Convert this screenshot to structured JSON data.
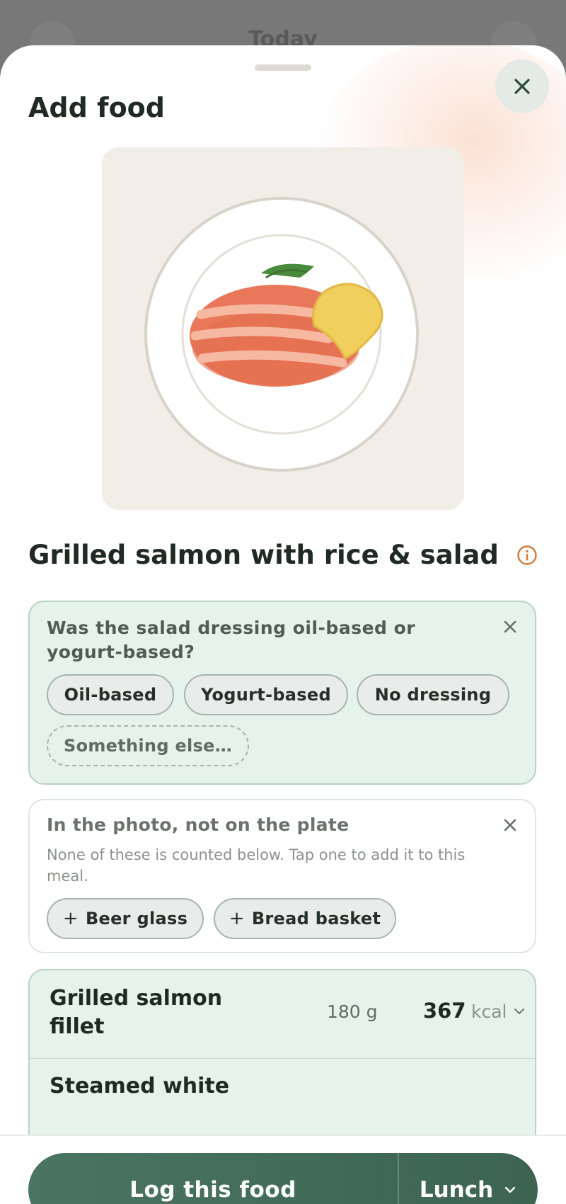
{
  "backdrop": {
    "title": "Today"
  },
  "sheet": {
    "title": "Add food",
    "close_icon": "close-icon"
  },
  "photo": {
    "alt": "Plate with grilled salmon fillet"
  },
  "food": {
    "name": "Grilled salmon with rice & salad",
    "info_icon": "info-icon"
  },
  "question": {
    "text": "Was the salad dressing oil-based or yogurt-based?",
    "options": [
      "Oil-based",
      "Yogurt-based",
      "No dressing"
    ],
    "other_option": "Something else…"
  },
  "photo_extras": {
    "title": "In the photo, not on the plate",
    "subtitle": "None of these is counted below. Tap one to add it to this meal.",
    "items": [
      "Beer glass",
      "Bread basket"
    ],
    "add_symbol": "+"
  },
  "items": [
    {
      "name": "Grilled salmon fillet",
      "grams": "180 g",
      "kcal": "367",
      "unit": "kcal"
    },
    {
      "name": "Steamed white",
      "grams": "",
      "kcal": "",
      "unit": ""
    }
  ],
  "action": {
    "log_label": "Log this food",
    "meal_label": "Lunch"
  },
  "colors": {
    "accent": "#3f6a55",
    "question_bg": "#e6f2ec",
    "info_orange": "#d27a3a"
  }
}
